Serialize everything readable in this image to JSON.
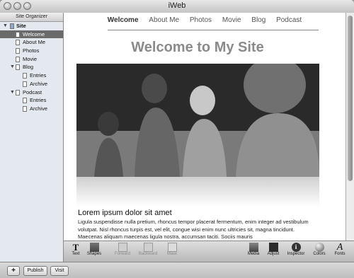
{
  "window": {
    "title": "iWeb"
  },
  "sidebar": {
    "header": "Site Organizer",
    "site_label": "Site",
    "items": [
      {
        "label": "Welcome",
        "selected": true
      },
      {
        "label": "About Me"
      },
      {
        "label": "Photos"
      },
      {
        "label": "Movie"
      },
      {
        "label": "Blog"
      },
      {
        "label": "Entries"
      },
      {
        "label": "Archive"
      },
      {
        "label": "Podcast"
      },
      {
        "label": "Entries"
      },
      {
        "label": "Archive"
      }
    ]
  },
  "page": {
    "nav": [
      "Welcome",
      "About Me",
      "Photos",
      "Movie",
      "Blog",
      "Podcast"
    ],
    "heading": "Welcome to My Site",
    "subheading": "Lorem ipsum dolor sit amet",
    "body": "Ligula suspendisse nulla pretium, rhoncus tempor placerat fermentum, enim integer ad vestibulum volutpat. Nisl rhoncus turpis est, vel elit, congue wisi enim nunc ultricies sit, magna tincidunt. Maecenas aliquam maecenas ligula nostra, accumsan taciti. Sociis mauris"
  },
  "toolbar": {
    "text": "Text",
    "shapes": "Shapes",
    "forward": "Forward",
    "backward": "Backward",
    "mask": "Mask",
    "media": "Media",
    "adjust": "Adjust",
    "inspector": "Inspector",
    "colors": "Colors",
    "fonts": "Fonts"
  },
  "bottom": {
    "add": "+",
    "publish": "Publish",
    "visit": "Visit"
  }
}
